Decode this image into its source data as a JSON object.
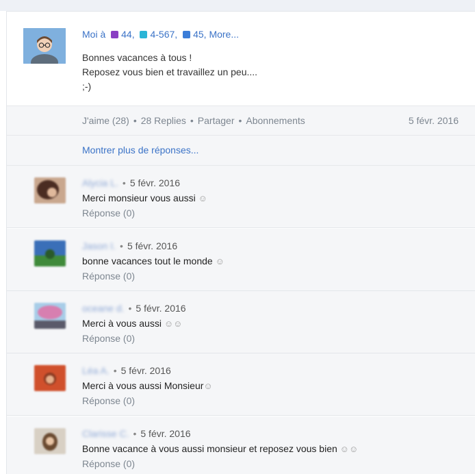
{
  "post": {
    "author_prefix": "Moi à",
    "groups": [
      {
        "label": "44",
        "color": "#8a3fc3"
      },
      {
        "label": "4-567",
        "color": "#2bb5d6"
      },
      {
        "label": "45,",
        "color": "#3b7dd8"
      }
    ],
    "more_label": "More...",
    "body_lines": [
      "Bonnes vacances à tous !",
      "Reposez vous bien et travaillez un peu....",
      ";-)"
    ]
  },
  "actions": {
    "like": "J'aime (28)",
    "replies": "28 Replies",
    "share": "Partager",
    "subscriptions": "Abonnements",
    "date": "5 févr. 2016",
    "separator": "•"
  },
  "show_more": "Montrer plus de réponses...",
  "replies": [
    {
      "author": "Alycia L.",
      "date": "5 févr. 2016",
      "text": "Merci monsieur vous aussi",
      "emoji": "☺",
      "reply_label": "Réponse (0)",
      "avatar_color": "#5a3a2a"
    },
    {
      "author": "Jason I.",
      "date": "5 févr. 2016",
      "text": "bonne vacances tout le monde",
      "emoji": "☺",
      "reply_label": "Réponse (0)",
      "avatar_color": "#2f7a3a"
    },
    {
      "author": "oceane d.",
      "date": "5 févr. 2016",
      "text": "Merci à vous aussi",
      "emoji": "☺☺",
      "reply_label": "Réponse (0)",
      "avatar_color": "#c97fa6"
    },
    {
      "author": "Léa A.",
      "date": "5 févr. 2016",
      "text": "Merci à vous aussi Monsieur",
      "emoji": "☺",
      "reply_label": "Réponse (0)",
      "avatar_color": "#c85c3c"
    },
    {
      "author": "Clarisse C.",
      "date": "5 févr. 2016",
      "text": "Bonne vacance à vous aussi monsieur et reposez vous bien",
      "emoji": "☺☺",
      "reply_label": "Réponse (0)",
      "avatar_color": "#9a7a5a"
    }
  ],
  "bullet": "•"
}
